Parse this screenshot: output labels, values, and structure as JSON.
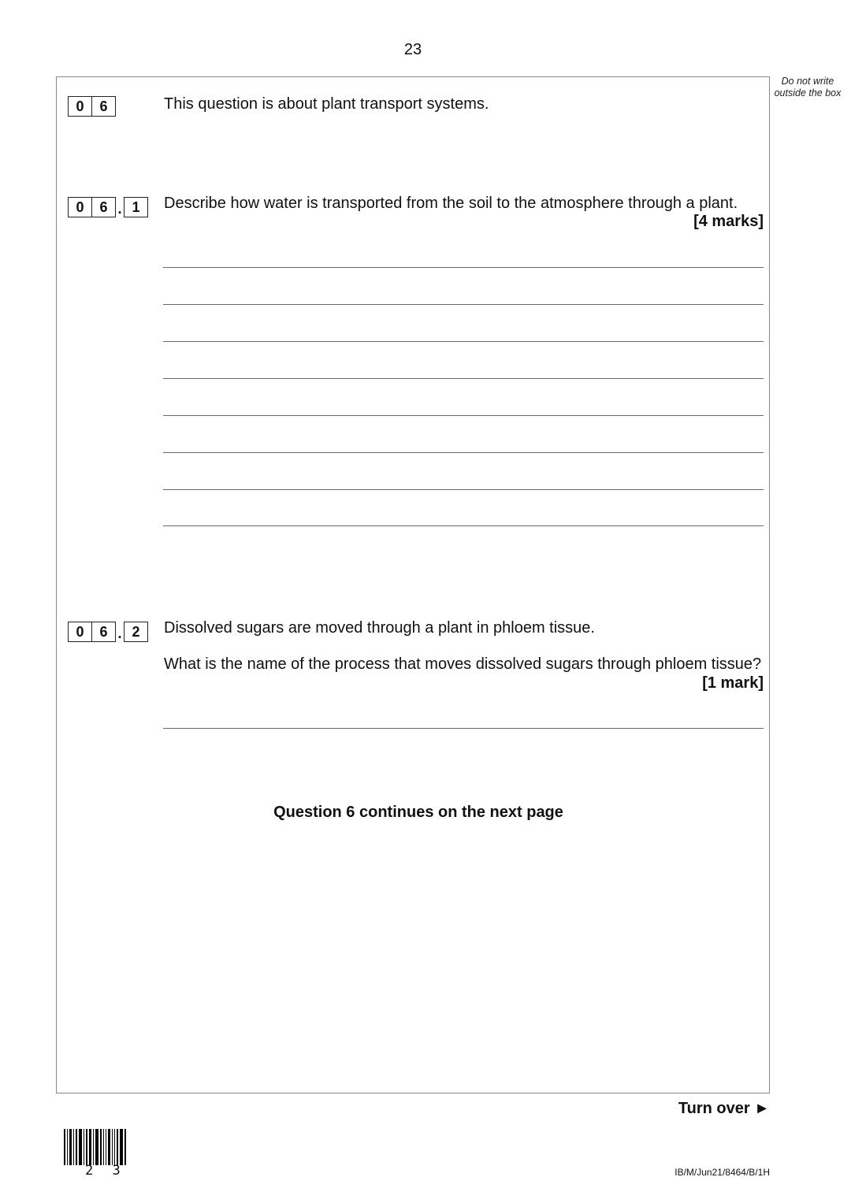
{
  "page": {
    "number": "23",
    "side_note": "Do not write outside the box",
    "turn_over": "Turn over ►",
    "paper_code": "IB/M/Jun21/8464/B/1H",
    "barcode_number": "2 3"
  },
  "question": {
    "number_digits": [
      "0",
      "6"
    ],
    "intro": "This question is about plant transport systems.",
    "parts": [
      {
        "sub": "1",
        "text": "Describe how water is transported from the soil to the atmosphere through a plant.",
        "marks": "[4 marks]",
        "answer_lines": 8
      },
      {
        "sub": "2",
        "lead": "Dissolved sugars are moved through a plant in phloem tissue.",
        "text": "What is the name of the process that moves dissolved sugars through phloem tissue?",
        "marks": "[1 mark]",
        "answer_lines": 1
      }
    ],
    "continues": "Question 6 continues on the next page"
  }
}
